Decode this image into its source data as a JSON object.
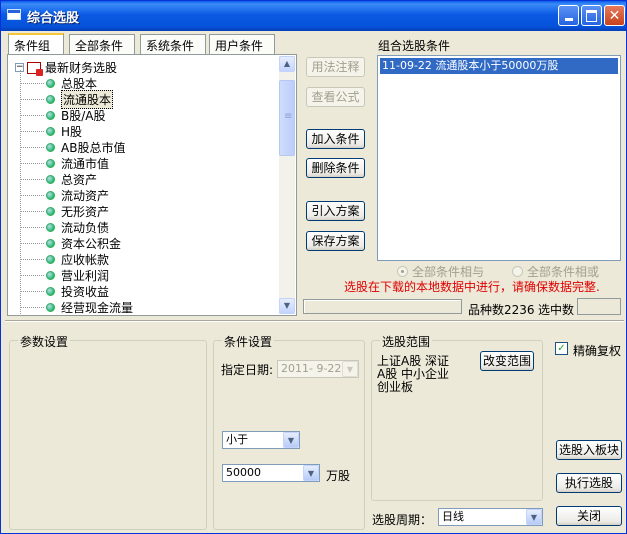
{
  "window": {
    "title": "综合选股"
  },
  "tabs": [
    {
      "label": "条件组",
      "active": true
    },
    {
      "label": "全部条件",
      "active": false
    },
    {
      "label": "系统条件",
      "active": false
    },
    {
      "label": "用户条件",
      "active": false
    }
  ],
  "tree": {
    "root_label": "最新财务选股",
    "expander": "−",
    "items": [
      {
        "label": "总股本"
      },
      {
        "label": "流通股本",
        "selected": true
      },
      {
        "label": "B股/A股"
      },
      {
        "label": "H股"
      },
      {
        "label": "AB股总市值"
      },
      {
        "label": "流通市值"
      },
      {
        "label": "总资产"
      },
      {
        "label": "流动资产"
      },
      {
        "label": "无形资产"
      },
      {
        "label": "流动负债"
      },
      {
        "label": "资本公积金"
      },
      {
        "label": "应收帐款"
      },
      {
        "label": "营业利润"
      },
      {
        "label": "投资收益"
      },
      {
        "label": "经营现金流量"
      }
    ]
  },
  "buttons": {
    "usage_note": "用法注释",
    "view_formula": "查看公式",
    "add_condition": "加入条件",
    "delete_condition": "删除条件",
    "import_scheme": "引入方案",
    "save_scheme": "保存方案",
    "change_range": "改变范围",
    "add_to_block": "选股入板块",
    "execute": "执行选股",
    "close": "关闭"
  },
  "combo": {
    "label": "组合选股条件",
    "rows": [
      "11-09-22  流通股本小于50000万股"
    ]
  },
  "match": {
    "all_and": "全部条件相与",
    "all_or": "全部条件相或"
  },
  "notice": "选股在下载的本地数据中进行，请确保数据完整.",
  "stats": {
    "variety_label": "品种数",
    "variety_count": "2236",
    "selected_label": "选中数"
  },
  "params": {
    "title": "参数设置"
  },
  "condition": {
    "title": "条件设置",
    "date_label": "指定日期:",
    "date_value": "2011- 9-22",
    "operator": "小于",
    "value": "50000",
    "unit": "万股"
  },
  "range": {
    "title": "选股范围",
    "lines": [
      "上证A股  深证",
      "A股  中小企业",
      "创业板"
    ]
  },
  "options": {
    "exact_restore_label": "精确复权",
    "exact_restore_checked": true,
    "checkmark": "✓",
    "period_label": "选股周期：",
    "period_value": "日线"
  },
  "icons": {
    "scroll_up": "▲",
    "scroll_down": "▼",
    "dropdown": "▼",
    "close": "✕"
  }
}
